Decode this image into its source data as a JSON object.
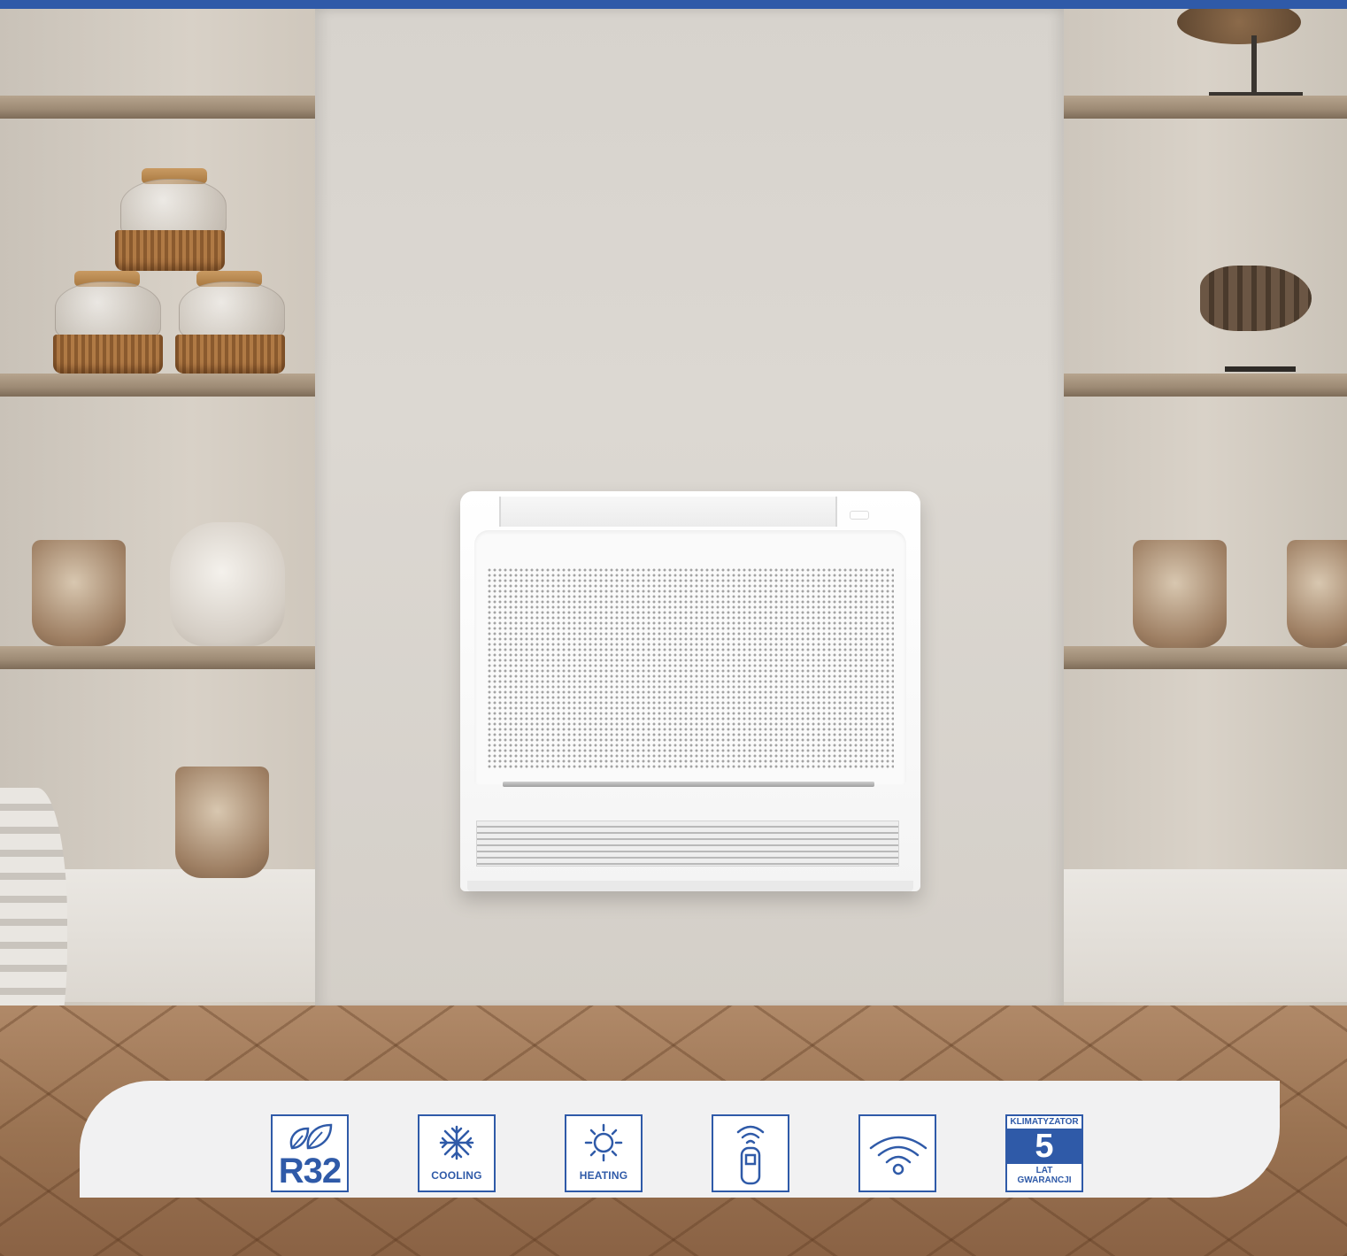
{
  "brand_color": "#2f5aa8",
  "features": [
    {
      "icon": "leaf-icon",
      "label": "R32"
    },
    {
      "icon": "snowflake-icon",
      "label": "COOLING"
    },
    {
      "icon": "sun-icon",
      "label": "HEATING"
    },
    {
      "icon": "remote-control-icon",
      "label": ""
    },
    {
      "icon": "wifi-icon",
      "label": ""
    },
    {
      "icon": "warranty-badge-icon",
      "top": "KLIMATYZATOR",
      "number": "5",
      "bottom_1": "LAT",
      "bottom_2": "GWARANCJI"
    }
  ]
}
